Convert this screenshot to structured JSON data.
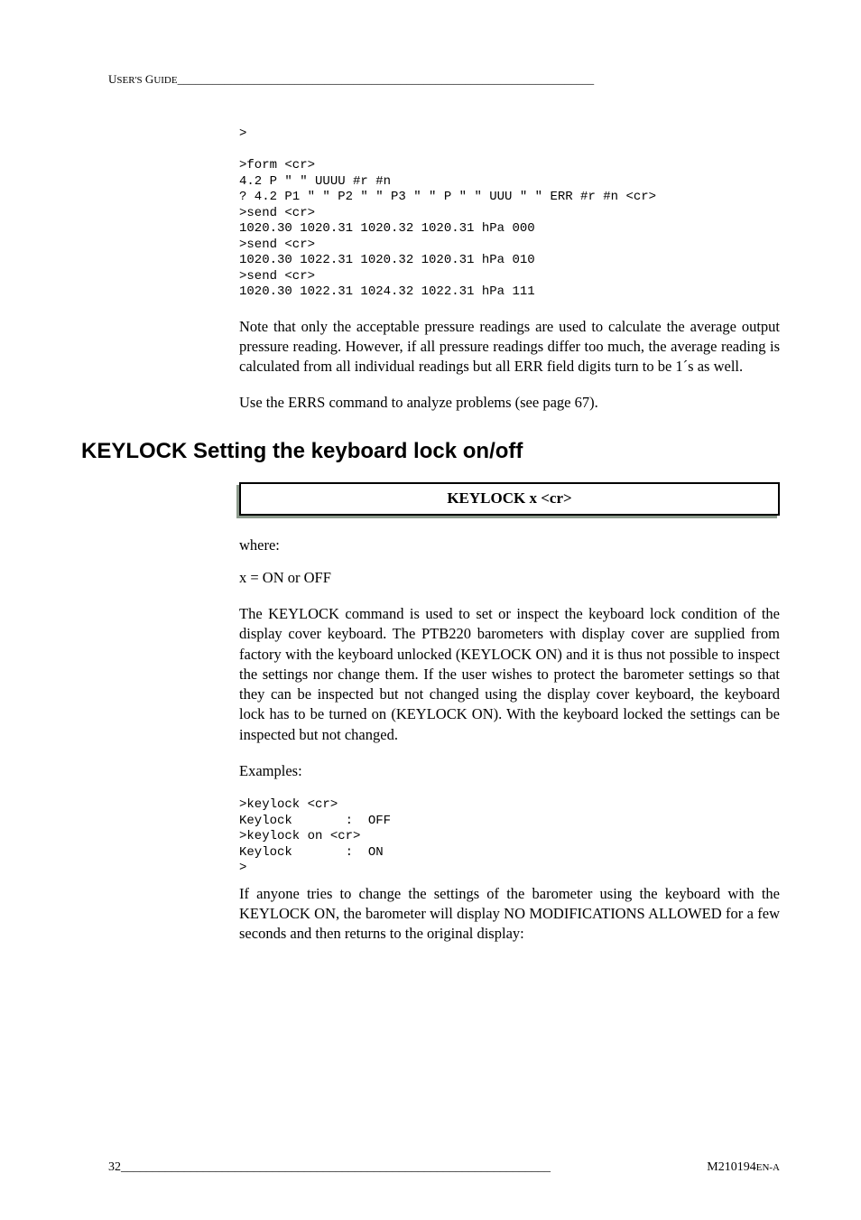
{
  "header": {
    "label": "User's Guide",
    "rule": "_______________________________________________________________________"
  },
  "code1": ">\n\n>form <cr>\n4.2 P \" \" UUUU #r #n\n? 4.2 P1 \" \" P2 \" \" P3 \" \" P \" \" UUU \" \" ERR #r #n <cr>\n>send <cr>\n1020.30 1020.31 1020.32 1020.31 hPa 000\n>send <cr>\n1020.30 1022.31 1020.32 1020.31 hPa 010\n>send <cr>\n1020.30 1022.31 1024.32 1022.31 hPa 111",
  "para1": "Note that only the acceptable pressure readings are used to calculate the average output pressure reading. However, if all pressure readings differ too much, the average reading is calculated from all individual readings but all ERR field digits turn to be 1´s as well.",
  "para2": "Use the ERRS command to analyze problems (see page 67).",
  "section_title": "KEYLOCK Setting the keyboard lock on/off",
  "cmd_box": "KEYLOCK  x <cr>",
  "where_label": "where:",
  "where_line": "x = ON or OFF",
  "para3": "The KEYLOCK command is used to set or inspect the keyboard lock condition of the display cover keyboard. The PTB220 barometers with display cover are supplied from factory with the keyboard unlocked (KEYLOCK ON) and it is thus not possible to inspect the settings nor change them. If the user wishes to protect the barometer settings so that they can be inspected but not changed using the display cover keyboard, the keyboard lock has to be turned on (KEYLOCK ON). With the keyboard locked the settings can be inspected but not changed.",
  "examples_label": "Examples:",
  "code2": ">keylock <cr>\nKeylock       :  OFF\n>keylock on <cr>\nKeylock       :  ON\n>",
  "para4": "If anyone tries to change the settings of the barometer using the keyboard with the KEYLOCK ON, the barometer will display NO MODIFICATIONS ALLOWED for a few seconds and then returns to the original display:",
  "footer": {
    "page_num": "32",
    "rule": " ____________________________________________________________________ ",
    "doc_id_prefix": "M210194",
    "doc_id_suffix": "EN-A"
  }
}
